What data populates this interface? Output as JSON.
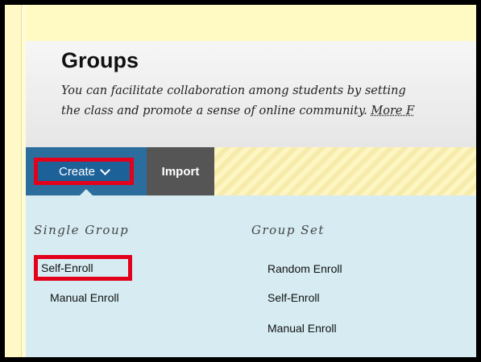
{
  "page": {
    "title": "Groups",
    "description_line1": "You can facilitate collaboration among students by setting",
    "description_line2": "the class and promote a sense of online community.",
    "more_link": "More F"
  },
  "toolbar": {
    "create_label": "Create",
    "import_label": "Import"
  },
  "menu": {
    "single_group": {
      "title": "Single Group",
      "items": [
        "Self-Enroll",
        "Manual Enroll"
      ]
    },
    "group_set": {
      "title": "Group Set",
      "items": [
        "Random Enroll",
        "Self-Enroll",
        "Manual Enroll"
      ]
    }
  },
  "colors": {
    "highlight": "#e3001b",
    "create_button": "#1d6199",
    "dropdown_bg": "#d6ecf2"
  },
  "icons": {
    "create_dropdown": "chevron-down-icon"
  }
}
